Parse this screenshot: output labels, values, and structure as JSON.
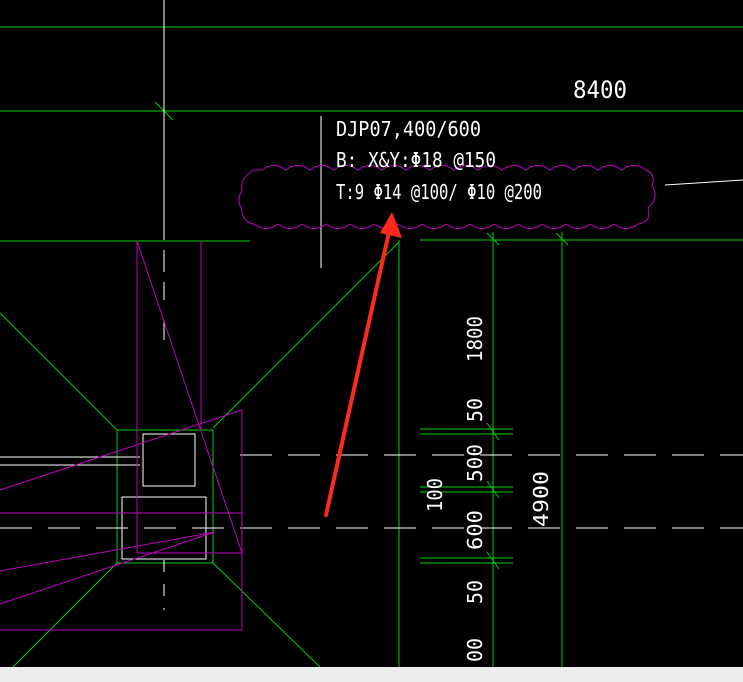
{
  "drawing": {
    "dimension_top": "8400",
    "annotation": {
      "line1": "DJP07,400/600",
      "line2": "B:  X&Y:Φ18 @150",
      "line3": "T:9 Φ14 @100/ Φ10 @200"
    },
    "dims_vertical": {
      "d1800": "1800",
      "d50_upper": "50",
      "d500": "500",
      "d100": "100",
      "d4900": "4900",
      "d600": "600",
      "d50_lower": "50",
      "d00": "00"
    },
    "colors": {
      "background": "#000000",
      "axis_lines": "#00d000",
      "foundation_outline": "#c000c0",
      "revision_cloud": "#c000c0",
      "pointer_arrow": "#ff2a1a",
      "text": "#ffffff"
    }
  }
}
